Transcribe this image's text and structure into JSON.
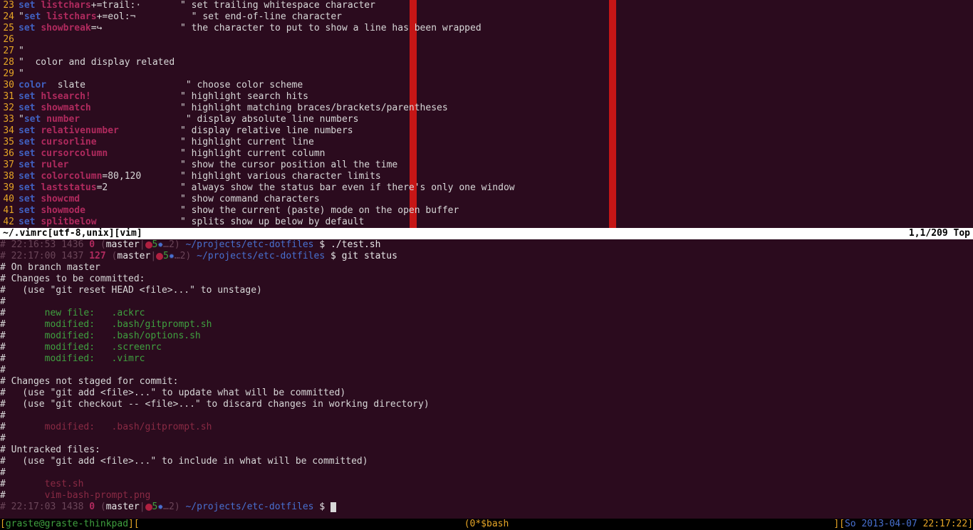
{
  "vim": {
    "lines": [
      {
        "n": "23",
        "pre": "",
        "kw": "set",
        "opt": "listchars",
        "rest": "+=trail:·",
        "pad": "       ",
        "cmt": "\" set trailing whitespace character"
      },
      {
        "n": "24",
        "pre": "\"",
        "kw": "set",
        "opt": "listchars",
        "rest": "+=eol:¬",
        "pad": "          ",
        "cmt": "\" set end-of-line character"
      },
      {
        "n": "25",
        "pre": "",
        "kw": "set",
        "opt": "showbreak",
        "rest": "=↪",
        "pad": "              ",
        "cmt": "\" the character to put to show a line has been wrapped"
      },
      {
        "n": "26",
        "pre": "",
        "kw": "",
        "opt": "",
        "rest": "",
        "pad": "",
        "cmt": ""
      },
      {
        "n": "27",
        "pre": "\"",
        "kw": "",
        "opt": "",
        "rest": "",
        "pad": "",
        "cmt": ""
      },
      {
        "n": "28",
        "pre": "\"",
        "kw": "",
        "opt": "",
        "rest": "",
        "pad": "",
        "cmt": "  color and display related"
      },
      {
        "n": "29",
        "pre": "\"",
        "kw": "",
        "opt": "",
        "rest": "",
        "pad": "",
        "cmt": ""
      },
      {
        "n": "30",
        "pre": "",
        "kw": "color",
        "opt": "",
        "rest": " slate",
        "pad": "                  ",
        "cmt": "\" choose color scheme"
      },
      {
        "n": "31",
        "pre": "",
        "kw": "set",
        "opt": "hlsearch!",
        "rest": "",
        "pad": "                ",
        "cmt": "\" highlight search hits"
      },
      {
        "n": "32",
        "pre": "",
        "kw": "set",
        "opt": "showmatch",
        "rest": "",
        "pad": "                ",
        "cmt": "\" highlight matching braces/brackets/parentheses"
      },
      {
        "n": "33",
        "pre": "\"",
        "kw": "set",
        "opt": "number",
        "rest": "",
        "pad": "                   ",
        "cmt": "\" display absolute line numbers"
      },
      {
        "n": "34",
        "pre": "",
        "kw": "set",
        "opt": "relativenumber",
        "rest": "",
        "pad": "           ",
        "cmt": "\" display relative line numbers"
      },
      {
        "n": "35",
        "pre": "",
        "kw": "set",
        "opt": "cursorline",
        "rest": "",
        "pad": "               ",
        "cmt": "\" highlight current line"
      },
      {
        "n": "36",
        "pre": "",
        "kw": "set",
        "opt": "cursorcolumn",
        "rest": "",
        "pad": "             ",
        "cmt": "\" highlight current column"
      },
      {
        "n": "37",
        "pre": "",
        "kw": "set",
        "opt": "ruler",
        "rest": "",
        "pad": "                    ",
        "cmt": "\" show the cursor position all the time"
      },
      {
        "n": "38",
        "pre": "",
        "kw": "set",
        "opt": "colorcolumn",
        "rest": "=80,120",
        "pad": "       ",
        "cmt": "\" highlight various character limits"
      },
      {
        "n": "39",
        "pre": "",
        "kw": "set",
        "opt": "laststatus",
        "rest": "=2",
        "pad": "             ",
        "cmt": "\" always show the status bar even if there's only one window"
      },
      {
        "n": "40",
        "pre": "",
        "kw": "set",
        "opt": "showcmd",
        "rest": "",
        "pad": "                  ",
        "cmt": "\" show command characters"
      },
      {
        "n": "41",
        "pre": "",
        "kw": "set",
        "opt": "showmode",
        "rest": "",
        "pad": "                 ",
        "cmt": "\" show the current (paste) mode on the open buffer"
      },
      {
        "n": "42",
        "pre": "",
        "kw": "set",
        "opt": "splitbelow",
        "rest": "",
        "pad": "               ",
        "cmt": "\" splits show up below by default"
      }
    ],
    "status_left": "~/.vimrc[utf-8,unix][vim]",
    "status_right": "1,1/209 Top"
  },
  "term": {
    "p1": {
      "time": "22:16:53",
      "hist": "1436",
      "exit": "0",
      "branch": "master",
      "flags": "5",
      "ell": "…2",
      "path": "~/projects/etc-dotfiles",
      "cmd": "./test.sh"
    },
    "p2": {
      "time": "22:17:00",
      "hist": "1437",
      "exit": "127",
      "branch": "master",
      "flags": "5",
      "ell": "…2",
      "path": "~/projects/etc-dotfiles",
      "cmd": "git status"
    },
    "git": {
      "branch": "# On branch master",
      "to_commit": "# Changes to be committed:",
      "unstage_hint": "#   (use \"git reset HEAD <file>...\" to unstage)",
      "staged": [
        "#       new file:   .ackrc",
        "#       modified:   .bash/gitprompt.sh",
        "#       modified:   .bash/options.sh",
        "#       modified:   .screenrc",
        "#       modified:   .vimrc"
      ],
      "not_staged": "# Changes not staged for commit:",
      "add_hint": "#   (use \"git add <file>...\" to update what will be committed)",
      "checkout_hint": "#   (use \"git checkout -- <file>...\" to discard changes in working directory)",
      "unstaged": [
        "#       modified:   .bash/gitprompt.sh"
      ],
      "untracked": "# Untracked files:",
      "untracked_hint": "#   (use \"git add <file>...\" to include in what will be committed)",
      "untracked_files": [
        "#       test.sh",
        "#       vim-bash-prompt.png"
      ]
    },
    "p3": {
      "time": "22:17:03",
      "hist": "1438",
      "exit": "0",
      "branch": "master",
      "flags": "5",
      "ell": "…2",
      "path": "~/projects/etc-dotfiles"
    }
  },
  "bottom": {
    "left_open": "[",
    "user": "graste@graste-thinkpad",
    "left_close": "][",
    "center": "(0*$bash",
    "right_open": "][",
    "date": "So 2013-04-07",
    "time": "22:17:22",
    "right_close": "]"
  }
}
